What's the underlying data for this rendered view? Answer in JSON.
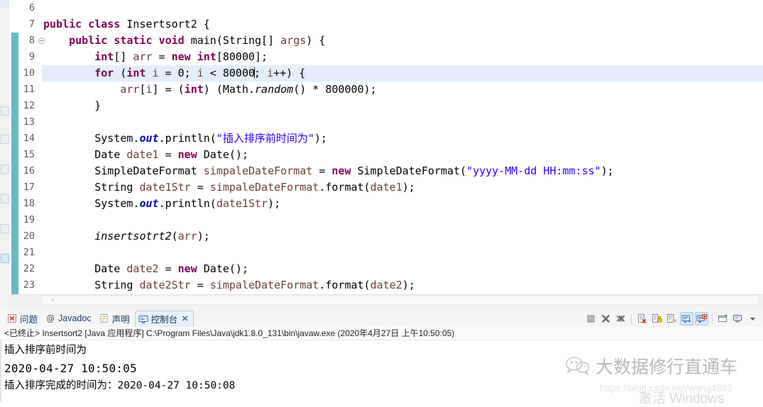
{
  "editor": {
    "lines": [
      {
        "no": "6",
        "fold": false,
        "current": false,
        "tokens": []
      },
      {
        "no": "7",
        "fold": false,
        "current": false,
        "tokens": [
          {
            "t": "kw",
            "s": "public "
          },
          {
            "t": "kw",
            "s": "class "
          },
          {
            "t": "cn",
            "s": "Insertsort2 {"
          }
        ]
      },
      {
        "no": "8",
        "fold": true,
        "current": false,
        "tokens": [
          {
            "t": "cn",
            "s": "    "
          },
          {
            "t": "kw",
            "s": "public "
          },
          {
            "t": "kw",
            "s": "static "
          },
          {
            "t": "kw",
            "s": "void "
          },
          {
            "t": "mthdecl",
            "s": "main"
          },
          {
            "t": "cn",
            "s": "(String[] "
          },
          {
            "t": "loc",
            "s": "args"
          },
          {
            "t": "cn",
            "s": ") {"
          }
        ]
      },
      {
        "no": "9",
        "fold": false,
        "current": false,
        "tokens": [
          {
            "t": "cn",
            "s": "        "
          },
          {
            "t": "kw",
            "s": "int"
          },
          {
            "t": "cn",
            "s": "[] "
          },
          {
            "t": "loc",
            "s": "arr"
          },
          {
            "t": "cn",
            "s": " = "
          },
          {
            "t": "kw",
            "s": "new "
          },
          {
            "t": "kw",
            "s": "int"
          },
          {
            "t": "cn",
            "s": "[80000];"
          }
        ]
      },
      {
        "no": "10",
        "fold": false,
        "current": true,
        "tokens": [
          {
            "t": "cn",
            "s": "        "
          },
          {
            "t": "kw",
            "s": "for "
          },
          {
            "t": "cn",
            "s": "("
          },
          {
            "t": "kw",
            "s": "int "
          },
          {
            "t": "loc",
            "s": "i"
          },
          {
            "t": "cn",
            "s": " = 0; "
          },
          {
            "t": "loc",
            "s": "i"
          },
          {
            "t": "cn",
            "s": " < 80000"
          },
          {
            "t": "caret",
            "s": ""
          },
          {
            "t": "cn",
            "s": "; "
          },
          {
            "t": "loc",
            "s": "i"
          },
          {
            "t": "cn",
            "s": "++) {"
          }
        ]
      },
      {
        "no": "11",
        "fold": false,
        "current": false,
        "tokens": [
          {
            "t": "cn",
            "s": "            "
          },
          {
            "t": "loc",
            "s": "arr"
          },
          {
            "t": "cn",
            "s": "["
          },
          {
            "t": "loc",
            "s": "i"
          },
          {
            "t": "cn",
            "s": "] = ("
          },
          {
            "t": "kw",
            "s": "int"
          },
          {
            "t": "cn",
            "s": ") (Math."
          },
          {
            "t": "mth",
            "s": "random"
          },
          {
            "t": "cn",
            "s": "() * 800000);"
          }
        ]
      },
      {
        "no": "12",
        "fold": false,
        "current": false,
        "tokens": [
          {
            "t": "cn",
            "s": "        }"
          }
        ]
      },
      {
        "no": "13",
        "fold": false,
        "current": false,
        "tokens": []
      },
      {
        "no": "14",
        "fold": false,
        "current": false,
        "tokens": [
          {
            "t": "cn",
            "s": "        System."
          },
          {
            "t": "fld",
            "s": "out"
          },
          {
            "t": "cn",
            "s": ".println("
          },
          {
            "t": "str",
            "s": "\"插入排序前时间为\""
          },
          {
            "t": "cn",
            "s": ");"
          }
        ]
      },
      {
        "no": "15",
        "fold": false,
        "current": false,
        "tokens": [
          {
            "t": "cn",
            "s": "        Date "
          },
          {
            "t": "loc",
            "s": "date1"
          },
          {
            "t": "cn",
            "s": " = "
          },
          {
            "t": "kw",
            "s": "new "
          },
          {
            "t": "cn",
            "s": "Date();"
          }
        ]
      },
      {
        "no": "16",
        "fold": false,
        "current": false,
        "tokens": [
          {
            "t": "cn",
            "s": "        SimpleDateFormat "
          },
          {
            "t": "loc",
            "s": "simpaleDateFormat"
          },
          {
            "t": "cn",
            "s": " = "
          },
          {
            "t": "kw",
            "s": "new "
          },
          {
            "t": "cn",
            "s": "SimpleDateFormat("
          },
          {
            "t": "str",
            "s": "\"yyyy-MM-dd HH:mm:ss\""
          },
          {
            "t": "cn",
            "s": ");"
          }
        ]
      },
      {
        "no": "17",
        "fold": false,
        "current": false,
        "tokens": [
          {
            "t": "cn",
            "s": "        String "
          },
          {
            "t": "loc",
            "s": "date1Str"
          },
          {
            "t": "cn",
            "s": " = "
          },
          {
            "t": "loc",
            "s": "simpaleDateFormat"
          },
          {
            "t": "cn",
            "s": ".format("
          },
          {
            "t": "loc",
            "s": "date1"
          },
          {
            "t": "cn",
            "s": ");"
          }
        ]
      },
      {
        "no": "18",
        "fold": false,
        "current": false,
        "tokens": [
          {
            "t": "cn",
            "s": "        System."
          },
          {
            "t": "fld",
            "s": "out"
          },
          {
            "t": "cn",
            "s": ".println("
          },
          {
            "t": "loc",
            "s": "date1Str"
          },
          {
            "t": "cn",
            "s": ");"
          }
        ]
      },
      {
        "no": "19",
        "fold": false,
        "current": false,
        "tokens": []
      },
      {
        "no": "20",
        "fold": false,
        "current": false,
        "tokens": [
          {
            "t": "cn",
            "s": "        "
          },
          {
            "t": "mth",
            "s": "insertsotrt2"
          },
          {
            "t": "cn",
            "s": "("
          },
          {
            "t": "loc",
            "s": "arr"
          },
          {
            "t": "cn",
            "s": ");"
          }
        ]
      },
      {
        "no": "21",
        "fold": false,
        "current": false,
        "tokens": []
      },
      {
        "no": "22",
        "fold": false,
        "current": false,
        "tokens": [
          {
            "t": "cn",
            "s": "        Date "
          },
          {
            "t": "loc",
            "s": "date2"
          },
          {
            "t": "cn",
            "s": " = "
          },
          {
            "t": "kw",
            "s": "new "
          },
          {
            "t": "cn",
            "s": "Date();"
          }
        ]
      },
      {
        "no": "23",
        "fold": false,
        "current": false,
        "tokens": [
          {
            "t": "cn",
            "s": "        String "
          },
          {
            "t": "loc",
            "s": "date2Str"
          },
          {
            "t": "cn",
            "s": " = "
          },
          {
            "t": "loc",
            "s": "simpaleDateFormat"
          },
          {
            "t": "cn",
            "s": ".format("
          },
          {
            "t": "loc",
            "s": "date2"
          },
          {
            "t": "cn",
            "s": ");"
          }
        ]
      }
    ],
    "hscroll_arrow": "‹"
  },
  "bottom_view": {
    "tabs": [
      {
        "label": "问题",
        "icon": "problems-icon",
        "active": false,
        "closable": false
      },
      {
        "label": "Javadoc",
        "icon": "javadoc-icon",
        "active": false,
        "closable": false
      },
      {
        "label": "声明",
        "icon": "declaration-icon",
        "active": false,
        "closable": false
      },
      {
        "label": "控制台",
        "icon": "console-icon",
        "active": true,
        "closable": true
      }
    ],
    "tab_close_glyph": "✕",
    "toolbar": [
      {
        "name": "terminate-button",
        "icon": "stop-square-icon",
        "pressed": false
      },
      {
        "name": "remove-launch-button",
        "icon": "remove-x-icon",
        "pressed": false
      },
      {
        "name": "remove-all-terminated-button",
        "icon": "remove-all-x-icon",
        "pressed": false
      },
      {
        "name": "clear-console-button",
        "icon": "clear-console-icon",
        "pressed": false
      },
      {
        "name": "scroll-lock-button",
        "icon": "scroll-lock-icon",
        "pressed": false
      },
      {
        "name": "word-wrap-button",
        "icon": "word-wrap-icon",
        "pressed": false
      },
      {
        "name": "show-console-on-output-button",
        "icon": "console-output-icon",
        "pressed": true
      },
      {
        "name": "show-console-on-error-button",
        "icon": "console-error-icon",
        "pressed": true
      },
      {
        "name": "pin-console-button",
        "icon": "pin-console-icon",
        "pressed": false
      },
      {
        "name": "display-selected-console-button",
        "icon": "display-console-icon",
        "pressed": false
      },
      {
        "name": "open-console-menu-button",
        "icon": "chevron-down-icon",
        "pressed": false
      }
    ],
    "status_line": "<已终止> Insertsort2 [Java 应用程序] C:\\Program Files\\Java\\jdk1.8.0_131\\bin\\javaw.exe  (2020年4月27日 上午10:50:05)",
    "console_output": [
      {
        "text": "插入排序前时间为",
        "mono": false
      },
      {
        "text": "2020-04-27 10:50:05",
        "mono": true
      },
      {
        "text": "插入排序完成的时间为：2020-04-27 10:50:08",
        "mono": false
      }
    ]
  },
  "watermarks": {
    "wechat_name": "大数据修行直通车",
    "blog_url": "https://blog.csdn.net/wang4892",
    "windows_activate": "激活 Windows"
  },
  "colors": {
    "keyword": "#7f0055",
    "string": "#2a00ff",
    "field": "#0000c0",
    "local": "#6a3e3e",
    "current_line": "#e4eefb",
    "change_bar": "#2e9db5",
    "tab_active_bg": "#e8f1fb"
  }
}
